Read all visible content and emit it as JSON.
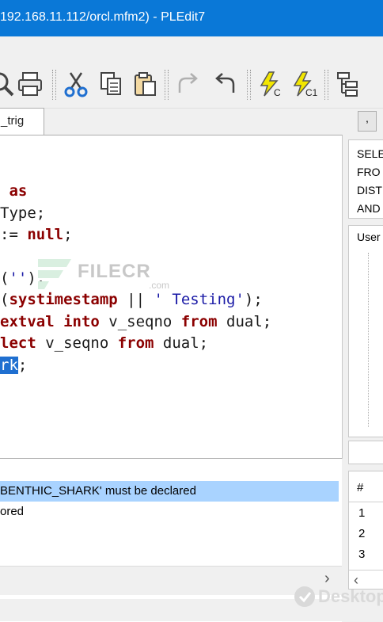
{
  "window": {
    "title": "192.168.11.112/orcl.mfm2) - PLEdit7"
  },
  "toolbar": {
    "icons": [
      "find-icon",
      "print-icon",
      "cut-icon",
      "copy-icon",
      "paste-icon",
      "redo-icon",
      "undo-icon",
      "execute-icon",
      "execute-current-icon",
      "structure-icon"
    ]
  },
  "tabs": [
    {
      "label": "_trig"
    }
  ],
  "editor": {
    "lines": [
      {
        "parts": [
          {
            "t": "",
            "c": ""
          }
        ]
      },
      {
        "parts": [
          {
            "t": " ",
            "c": ""
          },
          {
            "t": "as",
            "c": "kw"
          }
        ]
      },
      {
        "parts": [
          {
            "t": "Type;",
            "c": ""
          }
        ]
      },
      {
        "parts": [
          {
            "t": ":= ",
            "c": ""
          },
          {
            "t": "null",
            "c": "kw"
          },
          {
            "t": ";",
            "c": ""
          }
        ]
      },
      {
        "parts": [
          {
            "t": "",
            "c": ""
          }
        ]
      },
      {
        "parts": [
          {
            "t": "(",
            "c": ""
          },
          {
            "t": "''",
            "c": "str"
          },
          {
            "t": ");",
            "c": ""
          }
        ]
      },
      {
        "parts": [
          {
            "t": "(",
            "c": ""
          },
          {
            "t": "systimestamp",
            "c": "kw"
          },
          {
            "t": " || ",
            "c": ""
          },
          {
            "t": "' Testing'",
            "c": "str"
          },
          {
            "t": ");",
            "c": ""
          }
        ]
      },
      {
        "parts": [
          {
            "t": "extval ",
            "c": "kw"
          },
          {
            "t": "into",
            "c": "kw"
          },
          {
            "t": " v_seqno ",
            "c": ""
          },
          {
            "t": "from",
            "c": "kw"
          },
          {
            "t": " dual;",
            "c": ""
          }
        ]
      },
      {
        "parts": [
          {
            "t": "lect",
            "c": "kw"
          },
          {
            "t": " v_seqno ",
            "c": ""
          },
          {
            "t": "from",
            "c": "kw"
          },
          {
            "t": " dual;",
            "c": ""
          }
        ]
      },
      {
        "parts": [
          {
            "t": "rk",
            "c": "sel"
          },
          {
            "t": ";",
            "c": ""
          }
        ]
      }
    ]
  },
  "watermark": {
    "text": "FILECR",
    "sub": ".com"
  },
  "messages": [
    {
      "text": "BENTHIC_SHARK' must be declared",
      "highlighted": true
    },
    {
      "text": "ored",
      "highlighted": false
    }
  ],
  "messages_scroll_right": "›",
  "right_panel": {
    "button_label": ",",
    "sql_lines": [
      "SELE",
      "FRO",
      "DIST",
      "AND"
    ],
    "users_label": "User",
    "grid": {
      "header": "#",
      "rows": [
        "1",
        "2",
        "3"
      ],
      "scroll_left": "‹"
    }
  },
  "desktop_watermark": "Desktop"
}
